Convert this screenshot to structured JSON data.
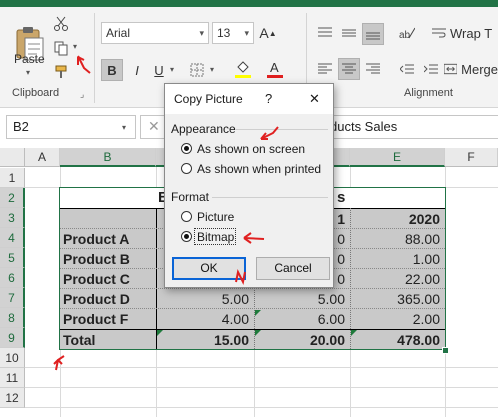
{
  "ribbon": {
    "clipboard": {
      "paste_label": "Paste",
      "group_label": "Clipboard"
    },
    "font": {
      "name": "Arial",
      "size": "13",
      "bold_label": "B",
      "italic_label": "I",
      "underline_label": "U"
    },
    "alignment": {
      "wrap_label": "Wrap T",
      "merge_label": "Merge",
      "group_label": "Alignment"
    }
  },
  "formula_bar": {
    "name_box": "B2",
    "formula_visible_text": "ducts Sales"
  },
  "columns": [
    "A",
    "B",
    "C",
    "D",
    "E",
    "F"
  ],
  "rows": [
    "1",
    "2",
    "3",
    "4",
    "5",
    "6",
    "7",
    "8",
    "9",
    "10",
    "11",
    "12"
  ],
  "sheet": {
    "title_fragment_left": "B",
    "title_fragment_right": "s",
    "header_year_d_fragment": "1",
    "header_year_e": "2020",
    "row_labels": [
      "Product A",
      "Product B",
      "Product C",
      "Product D",
      "Product F",
      "Total"
    ],
    "col_c": [
      "5.00",
      "4.00",
      "15.00"
    ],
    "col_d_fragments": [
      "0",
      "0",
      "0"
    ],
    "col_d": [
      "5.00",
      "6.00",
      "20.00"
    ],
    "col_e": [
      "88.00",
      "1.00",
      "22.00",
      "365.00",
      "2.00",
      "478.00"
    ]
  },
  "dialog": {
    "title": "Copy Picture",
    "help": "?",
    "close": "✕",
    "appearance_label": "Appearance",
    "appearance_options": [
      "As shown on screen",
      "As shown when printed"
    ],
    "appearance_selected": 0,
    "format_label": "Format",
    "format_options": [
      "Picture",
      "Bitmap"
    ],
    "format_selected": 1,
    "ok_label": "OK",
    "cancel_label": "Cancel"
  },
  "colors": {
    "excel_green": "#217346",
    "annotation_red": "#e02020",
    "dialog_default_border": "#0a64d6"
  },
  "icons": [
    "cut-icon",
    "copy-icon",
    "format-painter-icon",
    "paste-icon",
    "fill-color-icon",
    "font-color-icon",
    "borders-icon",
    "align-icon",
    "wrap-text-icon",
    "merge-icon",
    "dialog-launcher-icon"
  ]
}
